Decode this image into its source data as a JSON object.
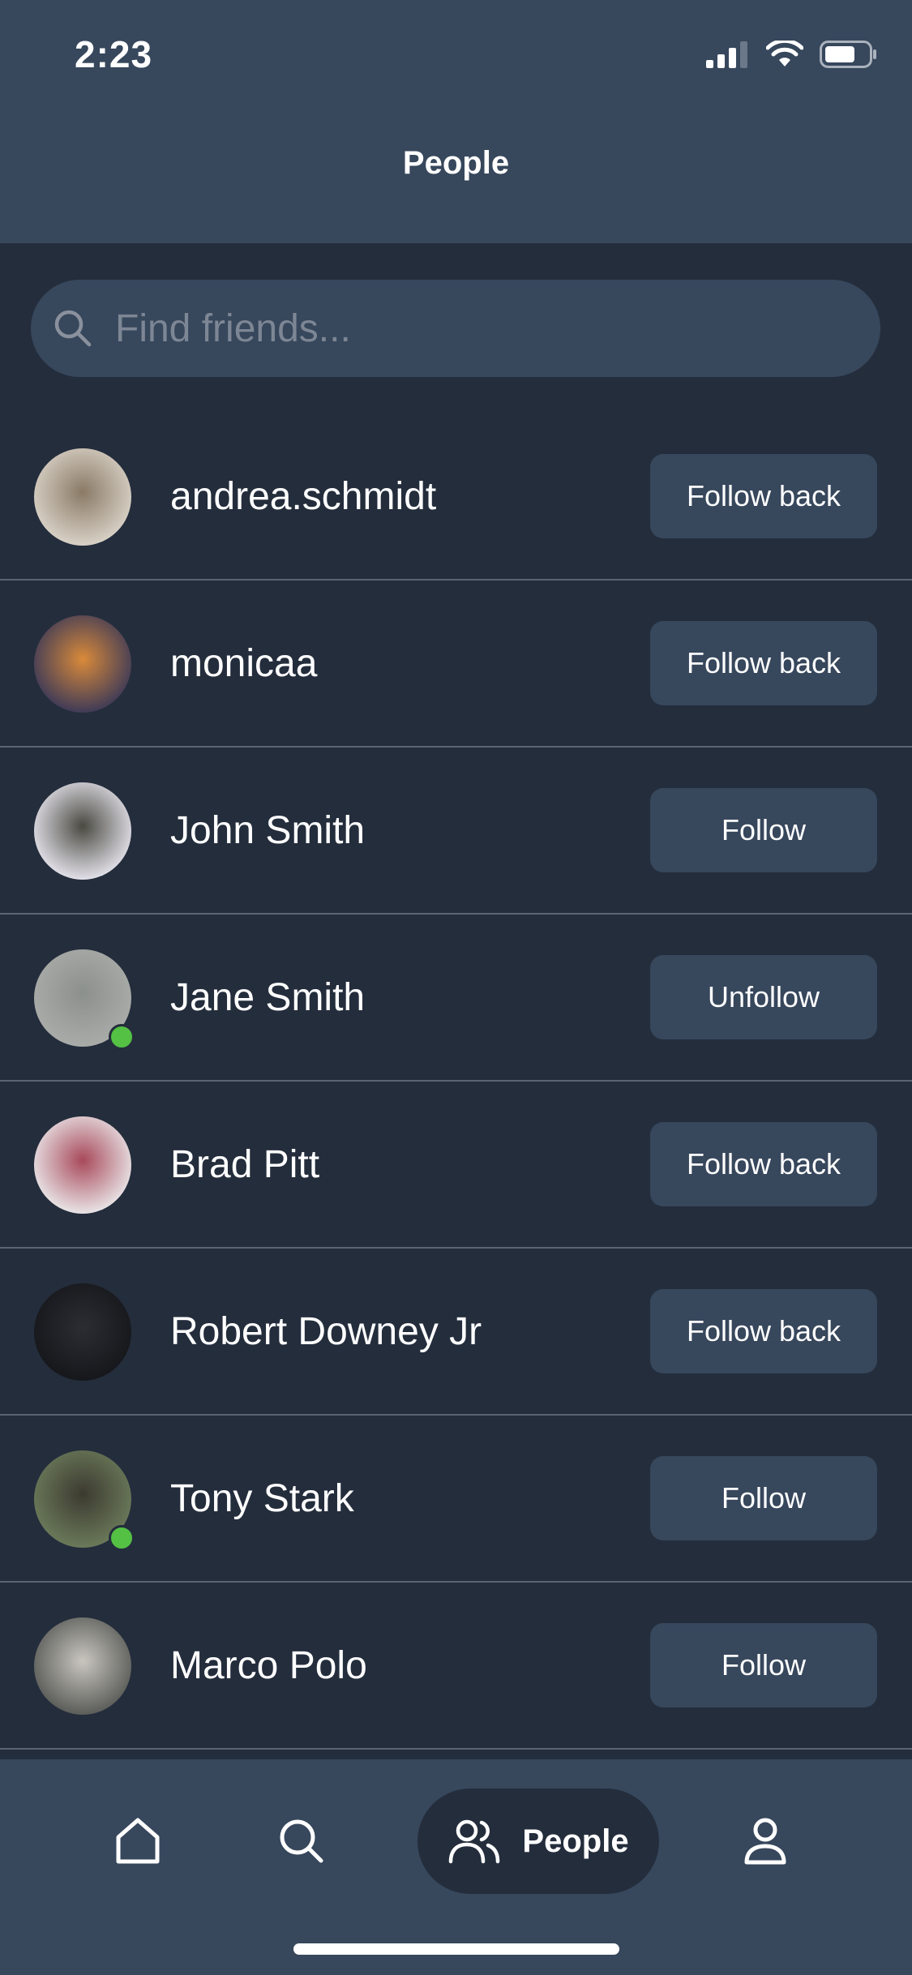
{
  "status_bar": {
    "time": "2:23"
  },
  "header": {
    "title": "People"
  },
  "search": {
    "placeholder": "Find friends..."
  },
  "people": [
    {
      "name": "andrea.schmidt",
      "action": "Follow back",
      "online": false,
      "avatar_colors": [
        "#d9d2c7",
        "#8a7a66"
      ]
    },
    {
      "name": "monicaa",
      "action": "Follow back",
      "online": false,
      "avatar_colors": [
        "#3e3a57",
        "#d98a3a"
      ]
    },
    {
      "name": "John Smith",
      "action": "Follow",
      "online": false,
      "avatar_colors": [
        "#e4e2ea",
        "#4a4a42"
      ]
    },
    {
      "name": "Jane Smith",
      "action": "Unfollow",
      "online": true,
      "avatar_colors": [
        "#a9aca8",
        "#8c908c"
      ]
    },
    {
      "name": "Brad Pitt",
      "action": "Follow back",
      "online": false,
      "avatar_colors": [
        "#e9e6e8",
        "#a8495a"
      ]
    },
    {
      "name": "Robert Downey Jr",
      "action": "Follow back",
      "online": false,
      "avatar_colors": [
        "#15171b",
        "#2b2d33"
      ]
    },
    {
      "name": "Tony Stark",
      "action": "Follow",
      "online": true,
      "avatar_colors": [
        "#6b7a5a",
        "#3c3a30"
      ]
    },
    {
      "name": "Marco Polo",
      "action": "Follow",
      "online": false,
      "avatar_colors": [
        "#5a5c58",
        "#c9c6c0"
      ]
    }
  ],
  "tabbar": {
    "active_label": "People"
  },
  "colors": {
    "bar": "#37475c",
    "background": "#242d3c",
    "online": "#54c044"
  }
}
